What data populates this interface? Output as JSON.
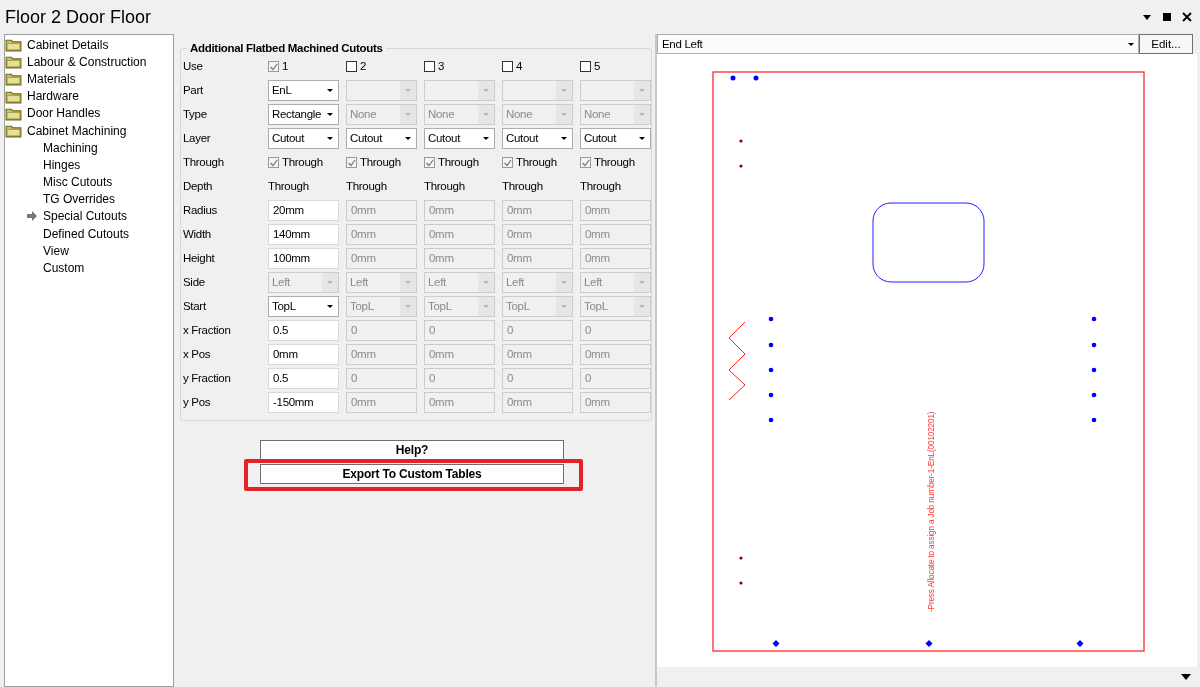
{
  "window": {
    "title": "Floor 2 Door Floor"
  },
  "sidebar": {
    "items": [
      {
        "label": "Cabinet Details",
        "kind": "folder",
        "selected": false
      },
      {
        "label": "Labour & Construction",
        "kind": "folder",
        "selected": false
      },
      {
        "label": "Materials",
        "kind": "folder",
        "selected": false
      },
      {
        "label": "Hardware",
        "kind": "folder",
        "selected": false
      },
      {
        "label": "Door Handles",
        "kind": "folder",
        "selected": false
      },
      {
        "label": "Cabinet Machining",
        "kind": "folder",
        "selected": false,
        "children": [
          {
            "label": "Machining",
            "kind": "page",
            "selected": false
          },
          {
            "label": "Hinges",
            "kind": "page",
            "selected": false
          },
          {
            "label": "Misc Cutouts",
            "kind": "page",
            "selected": false
          },
          {
            "label": "TG Overrides",
            "kind": "page",
            "selected": false
          },
          {
            "label": "Special Cutouts",
            "kind": "page",
            "selected": true
          },
          {
            "label": "Defined Cutouts",
            "kind": "page",
            "selected": false
          },
          {
            "label": "View",
            "kind": "page",
            "selected": false
          },
          {
            "label": "Custom",
            "kind": "page",
            "selected": false
          }
        ]
      }
    ]
  },
  "cutouts": {
    "title": "Additional Flatbed Machined Cutouts",
    "rows": [
      {
        "label": "Use",
        "kind": "check",
        "cells": [
          {
            "label": "1",
            "checked": true,
            "disabled": true
          },
          {
            "label": "2",
            "checked": false,
            "disabled": false
          },
          {
            "label": "3",
            "checked": false,
            "disabled": false
          },
          {
            "label": "4",
            "checked": false,
            "disabled": false
          },
          {
            "label": "5",
            "checked": false,
            "disabled": false
          }
        ]
      },
      {
        "label": "Part",
        "kind": "combo",
        "cells": [
          {
            "value": "EnL",
            "disabled": false
          },
          {
            "disabled": true
          },
          {
            "disabled": true
          },
          {
            "disabled": true
          },
          {
            "disabled": true
          }
        ]
      },
      {
        "label": "Type",
        "kind": "combo",
        "cells": [
          {
            "value": "Rectangle",
            "disabled": false
          },
          {
            "value": "None",
            "disabled": true
          },
          {
            "value": "None",
            "disabled": true
          },
          {
            "value": "None",
            "disabled": true
          },
          {
            "value": "None",
            "disabled": true
          }
        ]
      },
      {
        "label": "Layer",
        "kind": "combo",
        "cells": [
          {
            "value": "Cutout",
            "disabled": false
          },
          {
            "value": "Cutout",
            "disabled": false
          },
          {
            "value": "Cutout",
            "disabled": false
          },
          {
            "value": "Cutout",
            "disabled": false
          },
          {
            "value": "Cutout",
            "disabled": false
          }
        ]
      },
      {
        "label": "Through",
        "kind": "check",
        "cells": [
          {
            "label": "Through",
            "checked": true,
            "disabled": true
          },
          {
            "label": "Through",
            "checked": true,
            "disabled": true
          },
          {
            "label": "Through",
            "checked": true,
            "disabled": true
          },
          {
            "label": "Through",
            "checked": true,
            "disabled": true
          },
          {
            "label": "Through",
            "checked": true,
            "disabled": true
          }
        ]
      },
      {
        "label": "Depth",
        "kind": "text",
        "cells": [
          {
            "value": "Through"
          },
          {
            "value": "Through"
          },
          {
            "value": "Through"
          },
          {
            "value": "Through"
          },
          {
            "value": "Through"
          }
        ]
      },
      {
        "label": "Radius",
        "kind": "field",
        "cells": [
          {
            "value": "20mm",
            "disabled": false
          },
          {
            "value": "0mm",
            "disabled": true
          },
          {
            "value": "0mm",
            "disabled": true
          },
          {
            "value": "0mm",
            "disabled": true
          },
          {
            "value": "0mm",
            "disabled": true
          }
        ]
      },
      {
        "label": "Width",
        "kind": "field",
        "cells": [
          {
            "value": "140mm",
            "disabled": false
          },
          {
            "value": "0mm",
            "disabled": true
          },
          {
            "value": "0mm",
            "disabled": true
          },
          {
            "value": "0mm",
            "disabled": true
          },
          {
            "value": "0mm",
            "disabled": true
          }
        ]
      },
      {
        "label": "Height",
        "kind": "field",
        "cells": [
          {
            "value": "100mm",
            "disabled": false
          },
          {
            "value": "0mm",
            "disabled": true
          },
          {
            "value": "0mm",
            "disabled": true
          },
          {
            "value": "0mm",
            "disabled": true
          },
          {
            "value": "0mm",
            "disabled": true
          }
        ]
      },
      {
        "label": "Side",
        "kind": "combo",
        "cells": [
          {
            "value": "Left",
            "disabled": true
          },
          {
            "value": "Left",
            "disabled": true
          },
          {
            "value": "Left",
            "disabled": true
          },
          {
            "value": "Left",
            "disabled": true
          },
          {
            "value": "Left",
            "disabled": true
          }
        ]
      },
      {
        "label": "Start",
        "kind": "combo",
        "cells": [
          {
            "value": "TopL",
            "disabled": false
          },
          {
            "value": "TopL",
            "disabled": true
          },
          {
            "value": "TopL",
            "disabled": true
          },
          {
            "value": "TopL",
            "disabled": true
          },
          {
            "value": "TopL",
            "disabled": true
          }
        ]
      },
      {
        "label": "x Fraction",
        "kind": "field",
        "cells": [
          {
            "value": "0.5",
            "disabled": false
          },
          {
            "value": "0",
            "disabled": true
          },
          {
            "value": "0",
            "disabled": true
          },
          {
            "value": "0",
            "disabled": true
          },
          {
            "value": "0",
            "disabled": true
          }
        ]
      },
      {
        "label": "x Pos",
        "kind": "field",
        "cells": [
          {
            "value": "0mm",
            "disabled": false
          },
          {
            "value": "0mm",
            "disabled": true
          },
          {
            "value": "0mm",
            "disabled": true
          },
          {
            "value": "0mm",
            "disabled": true
          },
          {
            "value": "0mm",
            "disabled": true
          }
        ]
      },
      {
        "label": "y Fraction",
        "kind": "field",
        "cells": [
          {
            "value": "0.5",
            "disabled": false
          },
          {
            "value": "0",
            "disabled": true
          },
          {
            "value": "0",
            "disabled": true
          },
          {
            "value": "0",
            "disabled": true
          },
          {
            "value": "0",
            "disabled": true
          }
        ]
      },
      {
        "label": "y Pos",
        "kind": "field",
        "cells": [
          {
            "value": "-150mm",
            "disabled": false
          },
          {
            "value": "0mm",
            "disabled": true
          },
          {
            "value": "0mm",
            "disabled": true
          },
          {
            "value": "0mm",
            "disabled": true
          },
          {
            "value": "0mm",
            "disabled": true
          }
        ]
      }
    ]
  },
  "buttons": [
    {
      "label": "Help?",
      "highlighted": false
    },
    {
      "label": "Export To Custom Tables",
      "highlighted": true
    }
  ],
  "preview": {
    "view": "End Left",
    "edit_button": "Edit...",
    "job_label": "-Press Allocate to assign a Job number-1-EnL(00102201)"
  }
}
